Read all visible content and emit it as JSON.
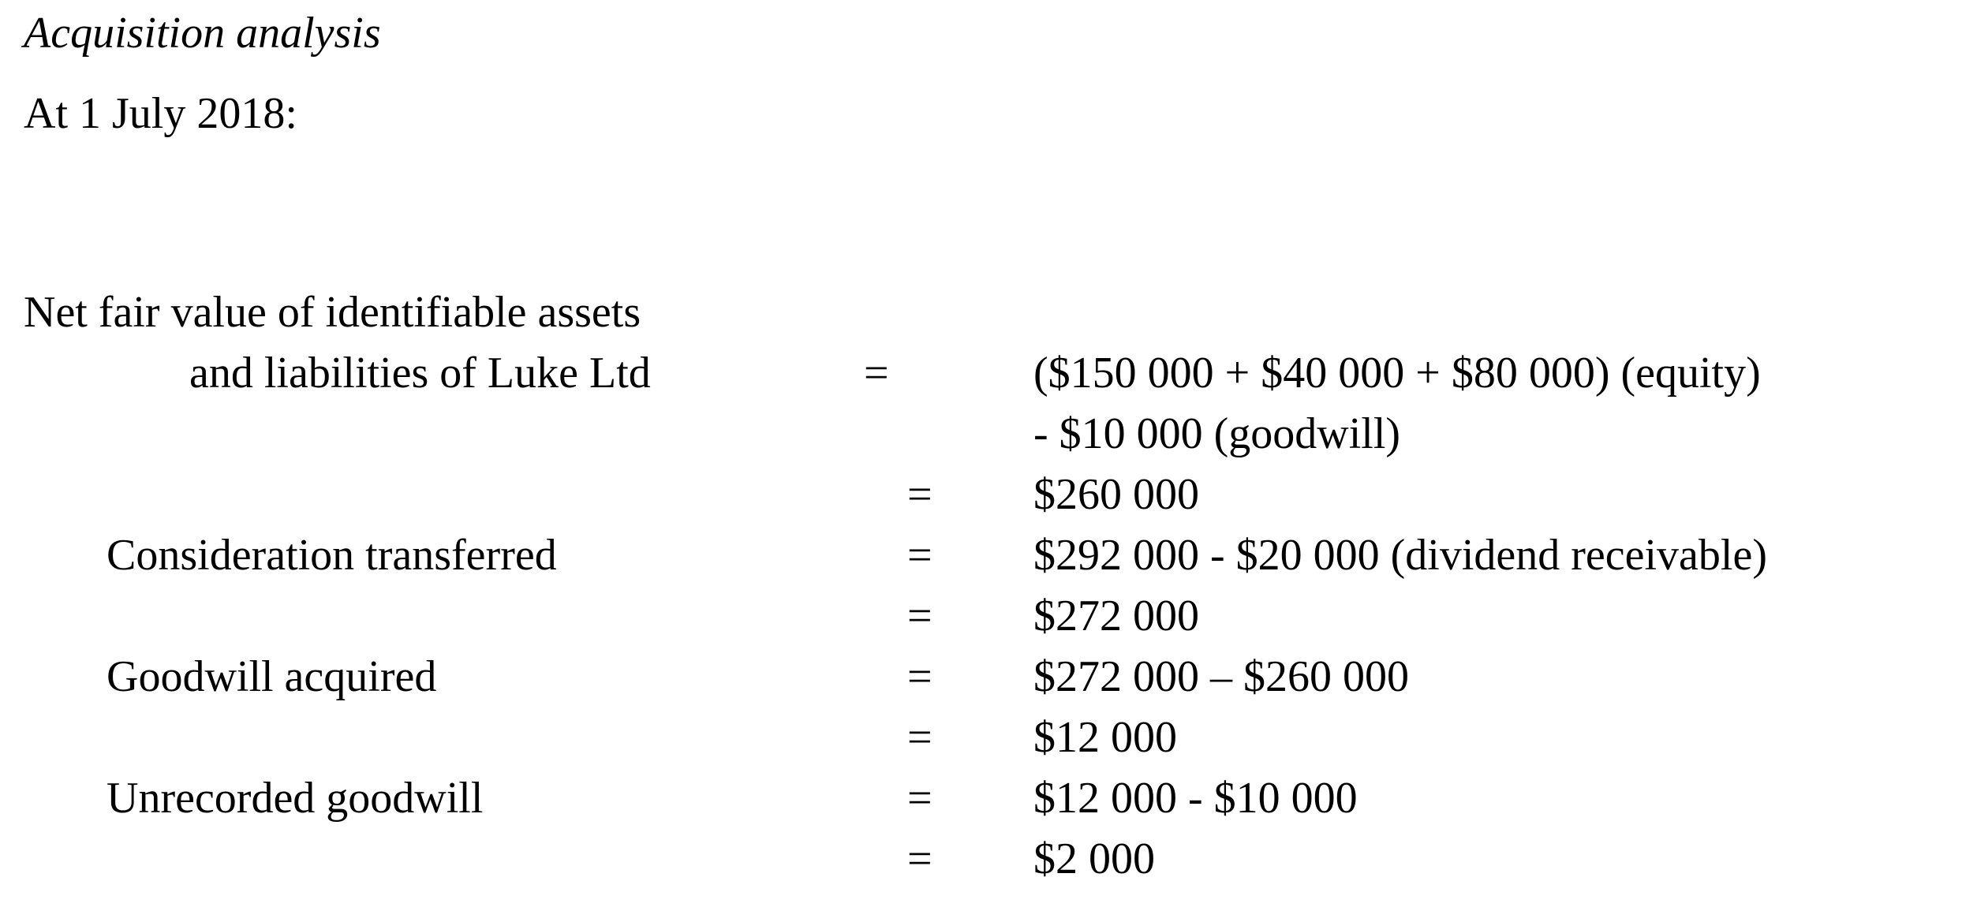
{
  "document": {
    "title": "Acquisition analysis",
    "date_line": "At 1 July 2018:",
    "equals_sign": "="
  },
  "rows": [
    {
      "label": "Net fair value of identifiable assets",
      "label2": "and liabilities of Luke Ltd",
      "eq": "=",
      "value": "($150 000 + $40 000 + $80 000) (equity)"
    },
    {
      "label": "",
      "eq": "",
      "value": "- $10 000 (goodwill)"
    },
    {
      "label": "",
      "eq": "=",
      "value": "$260 000"
    },
    {
      "label": "Consideration transferred",
      "eq": "=",
      "value": "$292 000 - $20 000 (dividend receivable)"
    },
    {
      "label": "",
      "eq": "=",
      "value": "$272 000"
    },
    {
      "label": "Goodwill acquired",
      "eq": "=",
      "value": "$272 000 – $260 000"
    },
    {
      "label": "",
      "eq": "=",
      "value": "$12 000"
    },
    {
      "label": "Unrecorded goodwill",
      "eq": "=",
      "value": "$12 000 - $10 000"
    },
    {
      "label": "",
      "eq": "=",
      "value": "$2 000"
    }
  ]
}
